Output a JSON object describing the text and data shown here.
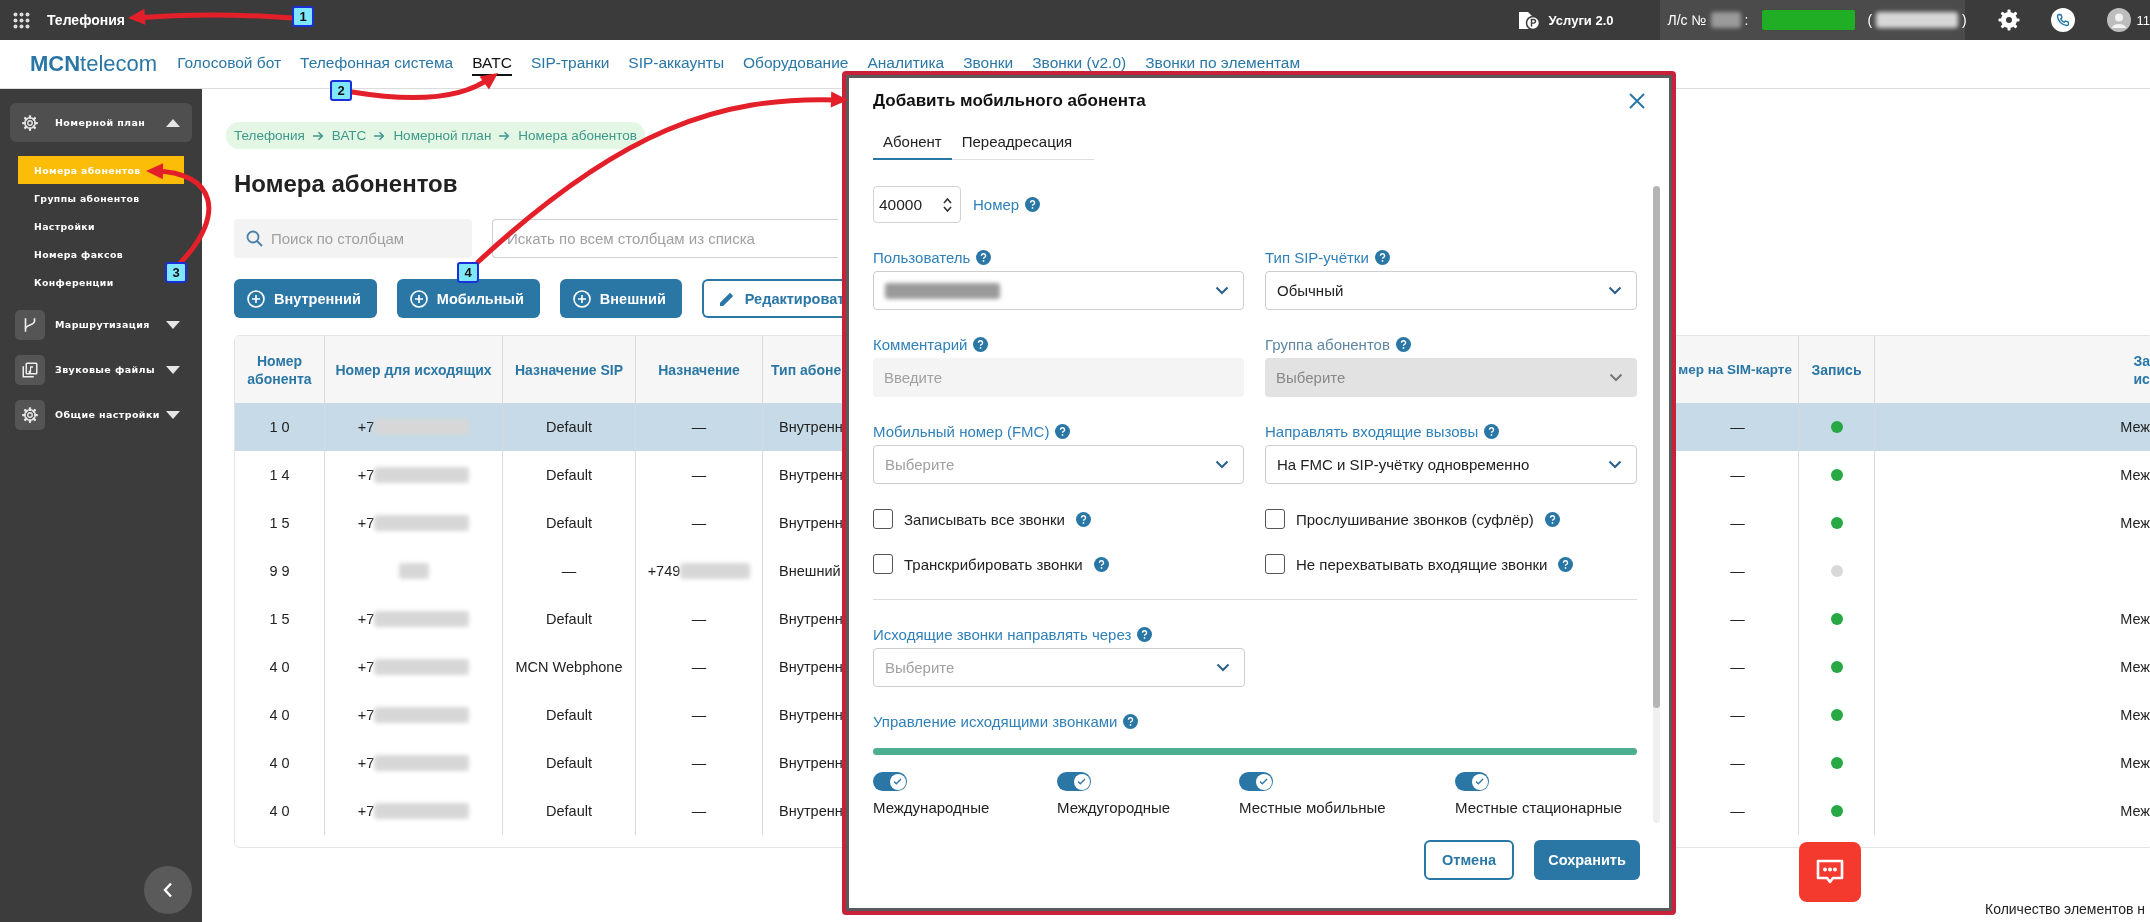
{
  "top_bar": {
    "app_title": "Телефония",
    "services": "Услуги 2.0",
    "account": {
      "prefix": "Л/с №",
      "number_masked": true,
      "separator": ":",
      "name_masked": true,
      "open_paren": "(",
      "detail_masked": true,
      "close_paren": ")"
    },
    "user": "11"
  },
  "nav": {
    "logo": {
      "bold": "MCN",
      "light": "telecom"
    },
    "links": [
      {
        "label": "Голосовой бот",
        "selected": false
      },
      {
        "label": "Телефонная система",
        "selected": false
      },
      {
        "label": "ВАТС",
        "selected": true
      },
      {
        "label": "SIP-транки",
        "selected": false
      },
      {
        "label": "SIP-аккаунты",
        "selected": false
      },
      {
        "label": "Оборудование",
        "selected": false
      },
      {
        "label": "Аналитика",
        "selected": false
      },
      {
        "label": "Звонки",
        "selected": false
      },
      {
        "label": "Звонки (v2.0)",
        "selected": false
      },
      {
        "label": "Звонки по элементам",
        "selected": false
      }
    ]
  },
  "sidebar": {
    "groups": [
      {
        "label": "Номерной план",
        "expanded": true,
        "children": [
          {
            "label": "Номера абонентов",
            "selected": true
          },
          {
            "label": "Группы абонентов",
            "selected": false
          },
          {
            "label": "Настройки",
            "selected": false
          },
          {
            "label": "Номера факсов",
            "selected": false
          },
          {
            "label": "Конференции",
            "selected": false
          }
        ]
      },
      {
        "label": "Маршрутизация",
        "expanded": false
      },
      {
        "label": "Звуковые файлы",
        "expanded": false
      },
      {
        "label": "Общие настройки",
        "expanded": false
      }
    ]
  },
  "breadcrumb": [
    "Телефония",
    "ВАТС",
    "Номерной план",
    "Номера абонентов"
  ],
  "page_title": "Номера абонентов",
  "column_search": {
    "placeholder": "Поиск по столбцам"
  },
  "global_search": {
    "placeholder": "Искать по всем столбцам из списка"
  },
  "actions": [
    {
      "label": "Внутренний",
      "kind": "add"
    },
    {
      "label": "Мобильный",
      "kind": "add"
    },
    {
      "label": "Внешний",
      "kind": "add"
    },
    {
      "label": "Редактироват",
      "kind": "edit"
    }
  ],
  "table": {
    "columns": [
      "Номер абонента",
      "Номер для исходящих",
      "Назначение SIP",
      "Назначение",
      "Тип абоне",
      "мер на SIM-карте",
      "Запись",
      "За\nис"
    ],
    "rows": [
      {
        "selected": true,
        "number": "1 0",
        "outgoing": "+7",
        "outgoing_masked": true,
        "sip": "Default",
        "destination": "—",
        "type": "Внутренн",
        "sim": "—",
        "recording": true,
        "column_8": "Меж"
      },
      {
        "selected": false,
        "number": "1 4",
        "outgoing": "+7",
        "outgoing_masked": true,
        "sip": "Default",
        "destination": "—",
        "type": "Внутренн",
        "sim": "—",
        "recording": true,
        "column_8": "Меж"
      },
      {
        "selected": false,
        "number": "1 5",
        "outgoing": "+7",
        "outgoing_masked": true,
        "sip": "Default",
        "destination": "—",
        "type": "Внутренн",
        "sim": "—",
        "recording": true,
        "column_8": "Меж"
      },
      {
        "selected": false,
        "number": "9 9",
        "outgoing_masked": true,
        "sip": "—",
        "destination": "+749",
        "destination_masked": true,
        "type": "Внешний",
        "sim": "—",
        "recording": false
      },
      {
        "selected": false,
        "number": "1 5",
        "outgoing": "+7",
        "outgoing_masked": true,
        "sip": "Default",
        "destination": "—",
        "type": "Внутренн",
        "sim": "—",
        "recording": true,
        "column_8": "Меж"
      },
      {
        "selected": false,
        "number": "4 0",
        "outgoing": "+7",
        "outgoing_masked": true,
        "sip": "MCN Webphone",
        "destination": "—",
        "type": "Внутренн",
        "sim": "—",
        "recording": true,
        "column_8": "Меж"
      },
      {
        "selected": false,
        "number": "4 0",
        "outgoing": "+7",
        "outgoing_masked": true,
        "sip": "Default",
        "destination": "—",
        "type": "Внутренн",
        "sim": "—",
        "recording": true,
        "column_8": "Меж"
      },
      {
        "selected": false,
        "number": "4 0",
        "outgoing": "+7",
        "outgoing_masked": true,
        "sip": "Default",
        "destination": "—",
        "type": "Внутренн",
        "sim": "—",
        "recording": true,
        "column_8": "Меж"
      },
      {
        "selected": false,
        "number": "4 0",
        "outgoing": "+7",
        "outgoing_masked": true,
        "sip": "Default",
        "destination": "—",
        "type": "Внутренн",
        "sim": "—",
        "recording": true,
        "column_8": "Меж"
      }
    ]
  },
  "footer": {
    "count_text": "Количество элементов н"
  },
  "dialog": {
    "title": "Добавить мобильного абонента",
    "tabs": [
      {
        "label": "Абонент",
        "selected": true
      },
      {
        "label": "Переадресация",
        "selected": false
      }
    ],
    "number": {
      "value": "40000",
      "label": "Номер"
    },
    "fields": [
      {
        "label": "Пользователь",
        "kind": "select",
        "value_masked": true,
        "disabled": false
      },
      {
        "label": "Тип SIP-учётки",
        "kind": "select",
        "value": "Обычный",
        "disabled": false
      },
      {
        "label": "Комментарий",
        "kind": "input",
        "placeholder": "Введите",
        "disabled": false
      },
      {
        "label": "Группа абонентов",
        "kind": "select",
        "placeholder": "Выберите",
        "disabled": true
      },
      {
        "label": "Мобильный номер (FMC)",
        "kind": "select",
        "placeholder": "Выберите",
        "disabled": false
      },
      {
        "label": "Направлять входящие вызовы",
        "kind": "select",
        "value": "На FMC и SIP-учётку одновременно",
        "disabled": false
      }
    ],
    "checkboxes": [
      {
        "label": "Записывать все звонки",
        "checked": false
      },
      {
        "label": "Прослушивание звонков (суфлёр)",
        "checked": false
      },
      {
        "label": "Транскрибировать звонки",
        "checked": false
      },
      {
        "label": "Не перехватывать входящие звонки",
        "checked": false
      }
    ],
    "outgoing_route": {
      "label": "Исходящие звонки направлять через",
      "placeholder": "Выберите"
    },
    "call_control": {
      "label": "Управление исходящими звонками",
      "level": 1,
      "toggles": [
        {
          "label": "Международные",
          "on": true
        },
        {
          "label": "Междугородные",
          "on": true
        },
        {
          "label": "Местные мобильные",
          "on": true
        },
        {
          "label": "Местные стационарные",
          "on": true
        }
      ]
    },
    "buttons": [
      {
        "label": "Отмена",
        "kind": "secondary"
      },
      {
        "label": "Сохранить",
        "kind": "primary"
      }
    ]
  },
  "annotations": [
    {
      "number": "1"
    },
    {
      "number": "2"
    },
    {
      "number": "3"
    },
    {
      "number": "4"
    }
  ]
}
